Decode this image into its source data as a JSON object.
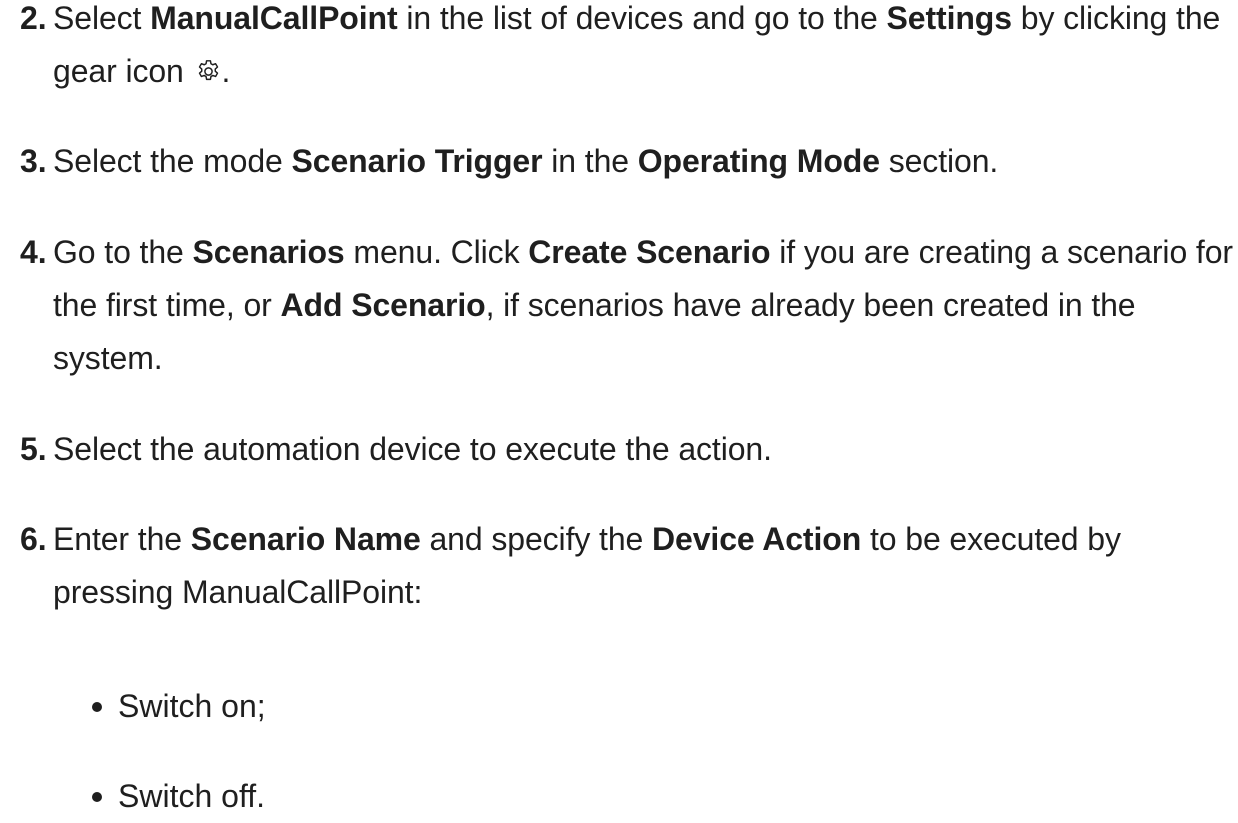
{
  "steps": [
    {
      "number": "2.",
      "segments": [
        {
          "t": "Select ",
          "b": false
        },
        {
          "t": "ManualCallPoint",
          "b": true
        },
        {
          "t": " in the list of devices and go to the ",
          "b": false
        },
        {
          "t": "Settings",
          "b": true
        },
        {
          "t": " by clicking the gear icon ",
          "b": false
        },
        {
          "icon": "gear-icon"
        },
        {
          "t": ".",
          "b": false
        }
      ]
    },
    {
      "number": "3.",
      "segments": [
        {
          "t": "Select the mode ",
          "b": false
        },
        {
          "t": "Scenario Trigger",
          "b": true
        },
        {
          "t": " in the ",
          "b": false
        },
        {
          "t": "Operating Mode",
          "b": true
        },
        {
          "t": " section.",
          "b": false
        }
      ]
    },
    {
      "number": "4.",
      "segments": [
        {
          "t": "Go to the ",
          "b": false
        },
        {
          "t": "Scenarios",
          "b": true
        },
        {
          "t": " menu. Click ",
          "b": false
        },
        {
          "t": "Create Scenario",
          "b": true
        },
        {
          "t": " if you are creating a scenario for the first time, or ",
          "b": false
        },
        {
          "t": "Add Scenario",
          "b": true
        },
        {
          "t": ", if scenarios have already been created in the system.",
          "b": false
        }
      ]
    },
    {
      "number": "5.",
      "segments": [
        {
          "t": "Select the automation device to execute the action.",
          "b": false
        }
      ]
    },
    {
      "number": "6.",
      "segments": [
        {
          "t": "Enter the ",
          "b": false
        },
        {
          "t": "Scenario Name",
          "b": true
        },
        {
          "t": " and specify the ",
          "b": false
        },
        {
          "t": "Device Action",
          "b": true
        },
        {
          "t": " to be executed by pressing ManualCallPoint:",
          "b": false
        }
      ]
    }
  ],
  "bullets": [
    "Switch on;",
    "Switch off."
  ],
  "colors": {
    "text": "#1f1f1f",
    "background": "#ffffff"
  }
}
